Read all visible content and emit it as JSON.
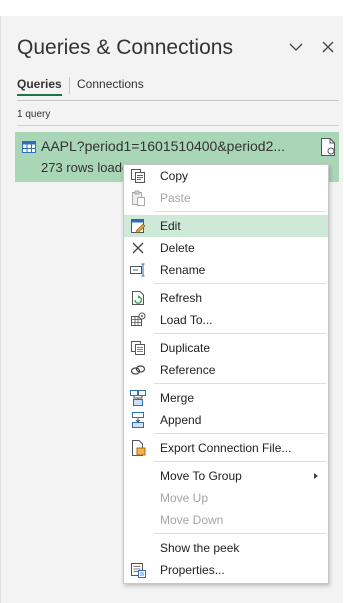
{
  "pane": {
    "title": "Queries & Connections",
    "tabs": [
      "Queries",
      "Connections"
    ],
    "count": "1 query"
  },
  "query": {
    "name": "AAPL?period1=1601510400&period2...",
    "rows": "273 rows loade"
  },
  "menu": {
    "items": [
      {
        "label": "Copy",
        "icon": "copy-icon",
        "enabled": true
      },
      {
        "label": "Paste",
        "icon": "paste-icon",
        "enabled": false
      },
      {
        "label": "Edit",
        "icon": "edit-icon",
        "enabled": true,
        "highlighted": true
      },
      {
        "label": "Delete",
        "icon": "delete-icon",
        "enabled": true
      },
      {
        "label": "Rename",
        "icon": "rename-icon",
        "enabled": true
      },
      {
        "label": "Refresh",
        "icon": "refresh-icon",
        "enabled": true
      },
      {
        "label": "Load To...",
        "icon": "load-to-icon",
        "enabled": true
      },
      {
        "label": "Duplicate",
        "icon": "duplicate-icon",
        "enabled": true
      },
      {
        "label": "Reference",
        "icon": "reference-icon",
        "enabled": true
      },
      {
        "label": "Merge",
        "icon": "merge-icon",
        "enabled": true
      },
      {
        "label": "Append",
        "icon": "append-icon",
        "enabled": true
      },
      {
        "label": "Export Connection File...",
        "icon": "export-connection-file-icon",
        "enabled": true
      },
      {
        "label": "Move To Group",
        "icon": "submenu-arrow-icon",
        "enabled": true
      },
      {
        "label": "Move Up",
        "enabled": false
      },
      {
        "label": "Move Down",
        "enabled": false
      },
      {
        "label": "Show the peek",
        "enabled": true
      },
      {
        "label": "Properties...",
        "icon": "properties-icon",
        "enabled": true
      }
    ]
  },
  "colors": {
    "accent": "#217346",
    "selected_row": "#a9d6b6",
    "menu_highlight": "#cfe9d8"
  }
}
